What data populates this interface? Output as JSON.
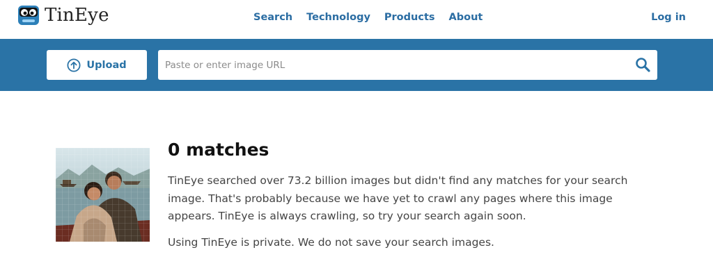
{
  "brand": {
    "name": "TinEye"
  },
  "nav": {
    "items": [
      {
        "label": "Search"
      },
      {
        "label": "Technology"
      },
      {
        "label": "Products"
      },
      {
        "label": "About"
      }
    ]
  },
  "header": {
    "login_label": "Log in"
  },
  "search": {
    "upload_label": "Upload",
    "url_placeholder": "Paste or enter image URL",
    "url_value": ""
  },
  "result": {
    "title": "0 matches",
    "description": "TinEye searched over 73.2 billion images but didn't find any matches for your search image. That's probably because we have yet to crawl any pages where this image appears. TinEye is always crawling, so try your search again soon.",
    "privacy": "Using TinEye is private. We do not save your search images."
  },
  "colors": {
    "accent": "#2a73a6",
    "link": "#2b6da3",
    "bar": "#2a73a6"
  },
  "icons": {
    "logo": "tineye-robot-logo",
    "upload": "upload-arrow-icon",
    "search": "magnifier-icon"
  }
}
